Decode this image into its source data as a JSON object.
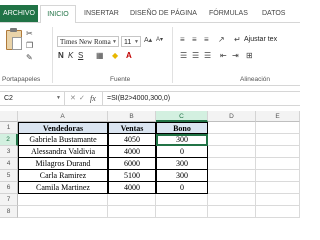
{
  "ribbon_tabs": [
    "ARCHIVO",
    "INICIO",
    "INSERTAR",
    "DISEÑO DE PÁGINA",
    "FÓRMULAS",
    "DATOS"
  ],
  "ribbon": {
    "font_name": "Times New Roma",
    "font_size": "11",
    "wrap_text": "Ajustar tex",
    "groups": [
      "Portapapeles",
      "Fuente",
      "Alineación"
    ]
  },
  "formula_bar": {
    "name_box": "C2",
    "fx": "fx",
    "formula": "=SI(B2>4000,300,0)"
  },
  "columns": [
    "A",
    "B",
    "C",
    "D",
    "E"
  ],
  "rows": [
    "1",
    "2",
    "3",
    "4",
    "5",
    "6",
    "7",
    "8"
  ],
  "table": {
    "headers": [
      "Vendedoras",
      "Ventas",
      "Bono"
    ],
    "data": [
      [
        "Gabriela Bustamante",
        "4050",
        "300"
      ],
      [
        "Alessandra Valdivia",
        "4000",
        "0"
      ],
      [
        "Milagros Durand",
        "6000",
        "300"
      ],
      [
        "Carla Ramirez",
        "5100",
        "300"
      ],
      [
        "Camila Martinez",
        "4000",
        "0"
      ]
    ]
  },
  "colors": {
    "accent": "#217346",
    "header_fill": "#dbe5f1"
  }
}
